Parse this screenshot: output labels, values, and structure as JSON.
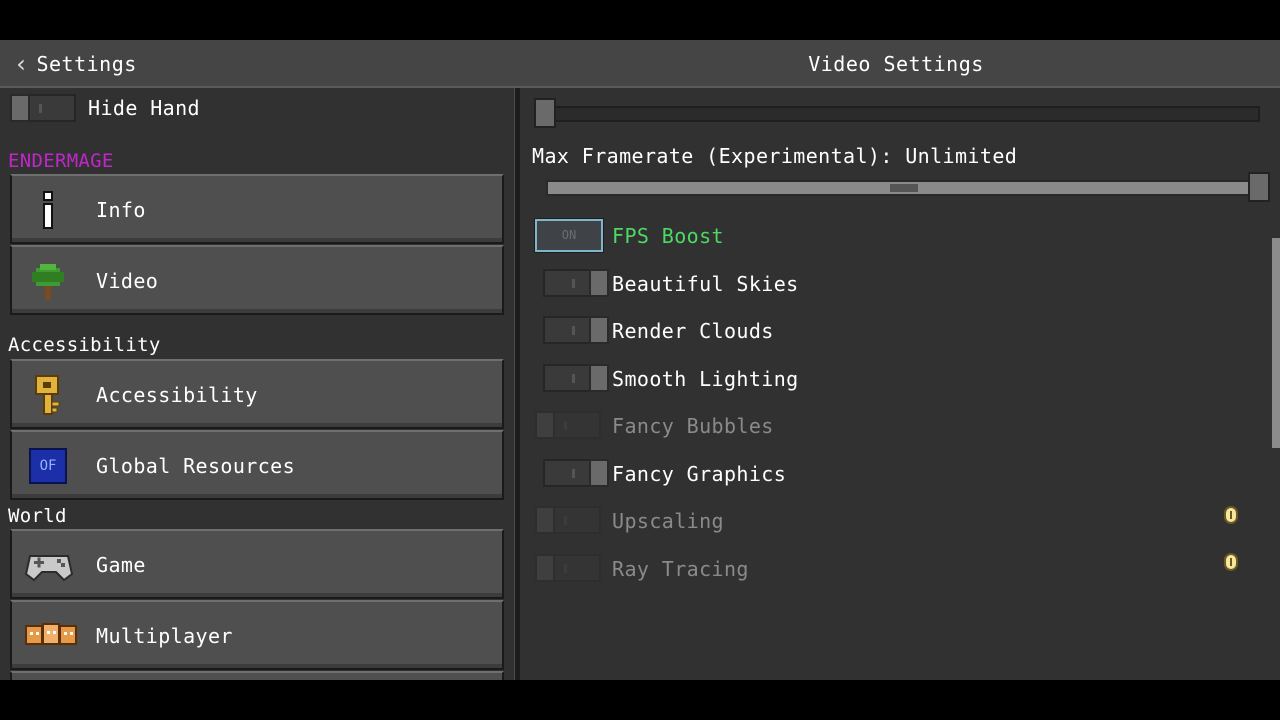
{
  "header": {
    "back_label": "Settings",
    "title": "Video Settings"
  },
  "sidebar": {
    "hide_hand_label": "Hide Hand",
    "brand_section": "ENDERMAGE",
    "accessibility_section": "Accessibility",
    "world_section": "World",
    "items": [
      {
        "label": "Info",
        "icon": "info-icon"
      },
      {
        "label": "Video",
        "icon": "tree-icon"
      },
      {
        "label": "Accessibility",
        "icon": "key-icon"
      },
      {
        "label": "Global Resources",
        "icon": "resource-pack-icon",
        "icon_text": "OF"
      },
      {
        "label": "Game",
        "icon": "controller-icon"
      },
      {
        "label": "Multiplayer",
        "icon": "players-icon"
      }
    ]
  },
  "video": {
    "max_framerate_label": "Max Framerate (Experimental): Unlimited",
    "options": [
      {
        "label": "FPS Boost",
        "state": "on",
        "toggle_text": "ON",
        "color": "#4cd964"
      },
      {
        "label": "Beautiful Skies",
        "state": "off"
      },
      {
        "label": "Render Clouds",
        "state": "off"
      },
      {
        "label": "Smooth Lighting",
        "state": "off"
      },
      {
        "label": "Fancy Bubbles",
        "state": "disabled"
      },
      {
        "label": "Fancy Graphics",
        "state": "off"
      },
      {
        "label": "Upscaling",
        "state": "disabled",
        "info": true
      },
      {
        "label": "Ray Tracing",
        "state": "disabled",
        "info": true
      }
    ]
  },
  "colors": {
    "brand": "#c026c9",
    "fps_boost": "#4cd964",
    "disabled_text": "#8a8a8a",
    "info_badge": "#f5e6a0"
  }
}
